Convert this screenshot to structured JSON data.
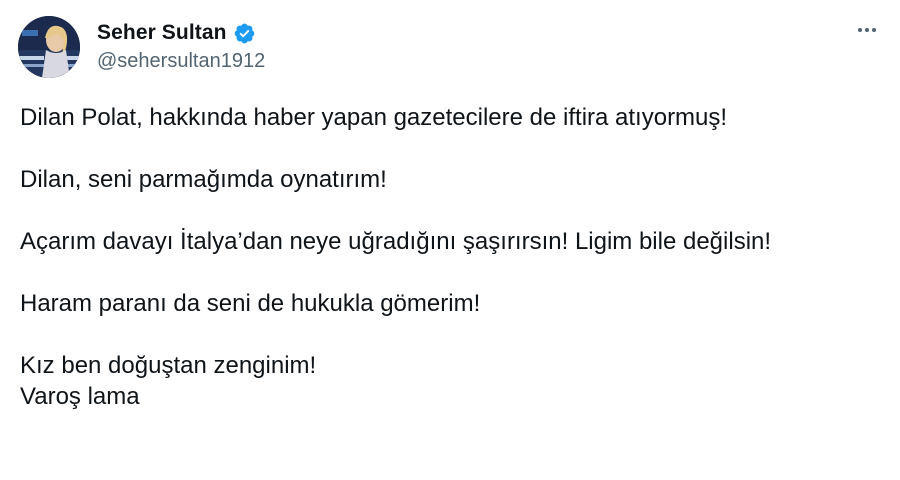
{
  "author": {
    "display_name": "Seher Sultan",
    "handle": "@sehersultan1912",
    "verified": true,
    "verified_color": "#1d9bf0"
  },
  "menu": {
    "icon": "more-horizontal-icon"
  },
  "tweet": {
    "paragraphs": [
      "Dilan Polat, hakkında haber yapan gazetecilere de iftira atıyormuş!",
      "Dilan, seni parmağımda oynatırım!",
      "Açarım davayı İtalya’dan neye uğradığını şaşırırsın! Ligim bile değilsin!",
      "Haram paranı da seni de hukukla gömerim!",
      "Kız ben doğuştan zenginim!\nVaroş lama"
    ]
  }
}
